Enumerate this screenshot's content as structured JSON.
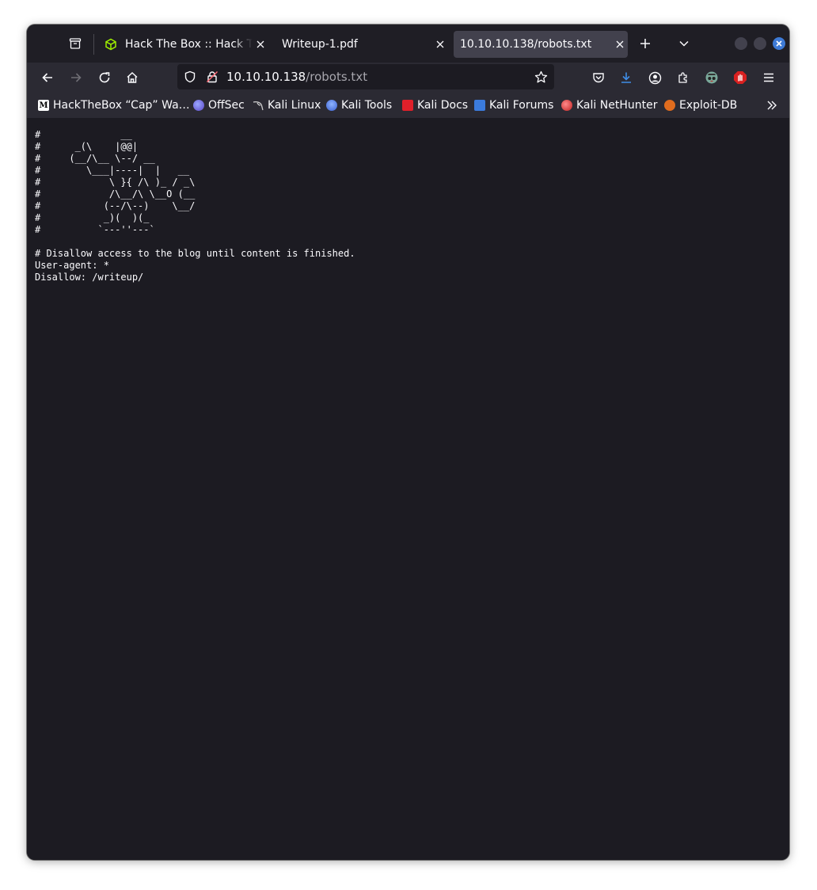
{
  "tabs": [
    {
      "title": "Hack The Box :: Hack The Box",
      "active": false,
      "favicon": "htb-cube-icon",
      "favicon_color": "#9fef00"
    },
    {
      "title": "Writeup-1.pdf",
      "active": false
    },
    {
      "title": "10.10.10.138/robots.txt",
      "active": true
    }
  ],
  "urlbar": {
    "host": "10.10.10.138",
    "path": "/robots.txt"
  },
  "bookmarks": [
    {
      "label": "HackTheBox “Cap” Wa…",
      "icon": "medium-icon",
      "color": "#ffffff"
    },
    {
      "label": "OffSec",
      "icon": "offsec-icon",
      "color": "#6d7fff"
    },
    {
      "label": "Kali Linux",
      "icon": "kali-dragon-icon",
      "color": "#d0d0d0"
    },
    {
      "label": "Kali Tools",
      "icon": "kali-tools-icon",
      "color": "#5b8dee"
    },
    {
      "label": "Kali Docs",
      "icon": "kali-docs-icon",
      "color": "#e0202a"
    },
    {
      "label": "Kali Forums",
      "icon": "kali-forums-icon",
      "color": "#3b7bdc"
    },
    {
      "label": "Kali NetHunter",
      "icon": "kali-nethunter-icon",
      "color": "#d83a3a"
    },
    {
      "label": "Exploit-DB",
      "icon": "exploit-db-icon",
      "color": "#e06c1e"
    }
  ],
  "robots_txt": "#              __\n#      _(\\    |@@|\n#     (__/\\__ \\--/ __\n#        \\___|----|  |   __\n#            \\ }{ /\\ )_ / _\\\n#            /\\__/\\ \\__O (__\n#           (--/\\--)    \\__/\n#           _)(  )(_\n#          `---''---`\n\n# Disallow access to the blog until content is finished.\nUser-agent: *\nDisallow: /writeup/"
}
